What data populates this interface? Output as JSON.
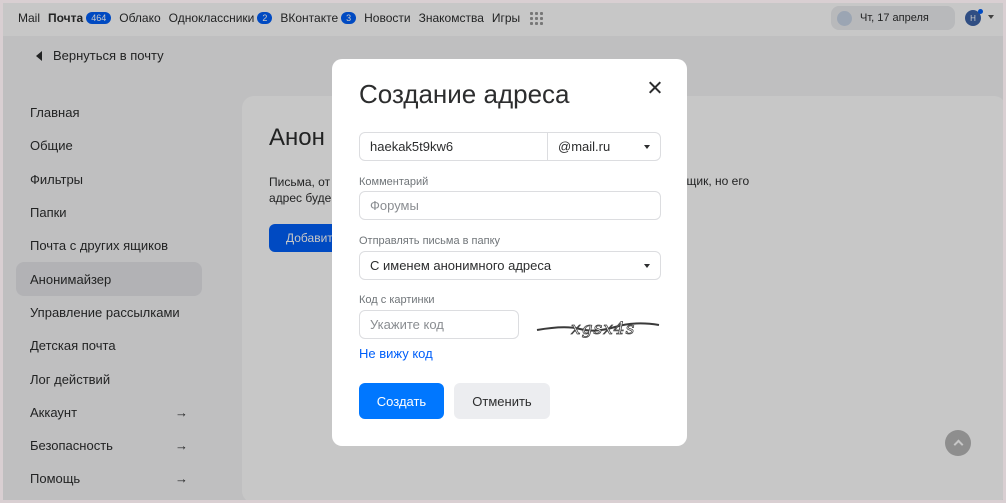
{
  "topbar": {
    "items": [
      {
        "label": "Mail"
      },
      {
        "label": "Почта",
        "badge": "464"
      },
      {
        "label": "Облако"
      },
      {
        "label": "Одноклассники",
        "badge": "2"
      },
      {
        "label": "ВКонтакте",
        "badge": "3"
      },
      {
        "label": "Новости"
      },
      {
        "label": "Знакомства"
      },
      {
        "label": "Игры"
      }
    ],
    "weather": "Чт, 17 апреля",
    "avatar_initial": "Н"
  },
  "back_link": "Вернуться в почту",
  "sidebar": {
    "items": [
      {
        "label": "Главная"
      },
      {
        "label": "Общие"
      },
      {
        "label": "Фильтры"
      },
      {
        "label": "Папки"
      },
      {
        "label": "Почта с других ящиков"
      },
      {
        "label": "Анонимайзер"
      },
      {
        "label": "Управление рассылками"
      },
      {
        "label": "Детская почта"
      },
      {
        "label": "Лог действий"
      },
      {
        "label": "Аккаунт",
        "arrow": "→"
      },
      {
        "label": "Безопасность",
        "arrow": "→"
      },
      {
        "label": "Помощь",
        "arrow": "→"
      }
    ]
  },
  "panel": {
    "title": "Анон",
    "text_line1": "Письма, от",
    "text_line2": "адрес буде",
    "text_right": "й ящик, но его",
    "button": "Добавит"
  },
  "modal": {
    "title": "Создание адреса",
    "address_value": "haekak5t9kw6",
    "domain": "@mail.ru",
    "comment_label": "Комментарий",
    "comment_placeholder": "Форумы",
    "folder_label": "Отправлять письма в папку",
    "folder_value": "С именем анонимного адреса",
    "captcha_label": "Код с картинки",
    "captcha_placeholder": "Укажите код",
    "captcha_text": "xgsx4s",
    "cant_see": "Не вижу код",
    "create": "Создать",
    "cancel": "Отменить"
  },
  "colors": {
    "accent": "#0077ff",
    "badge": "#005ff9",
    "link": "#005ff9"
  }
}
